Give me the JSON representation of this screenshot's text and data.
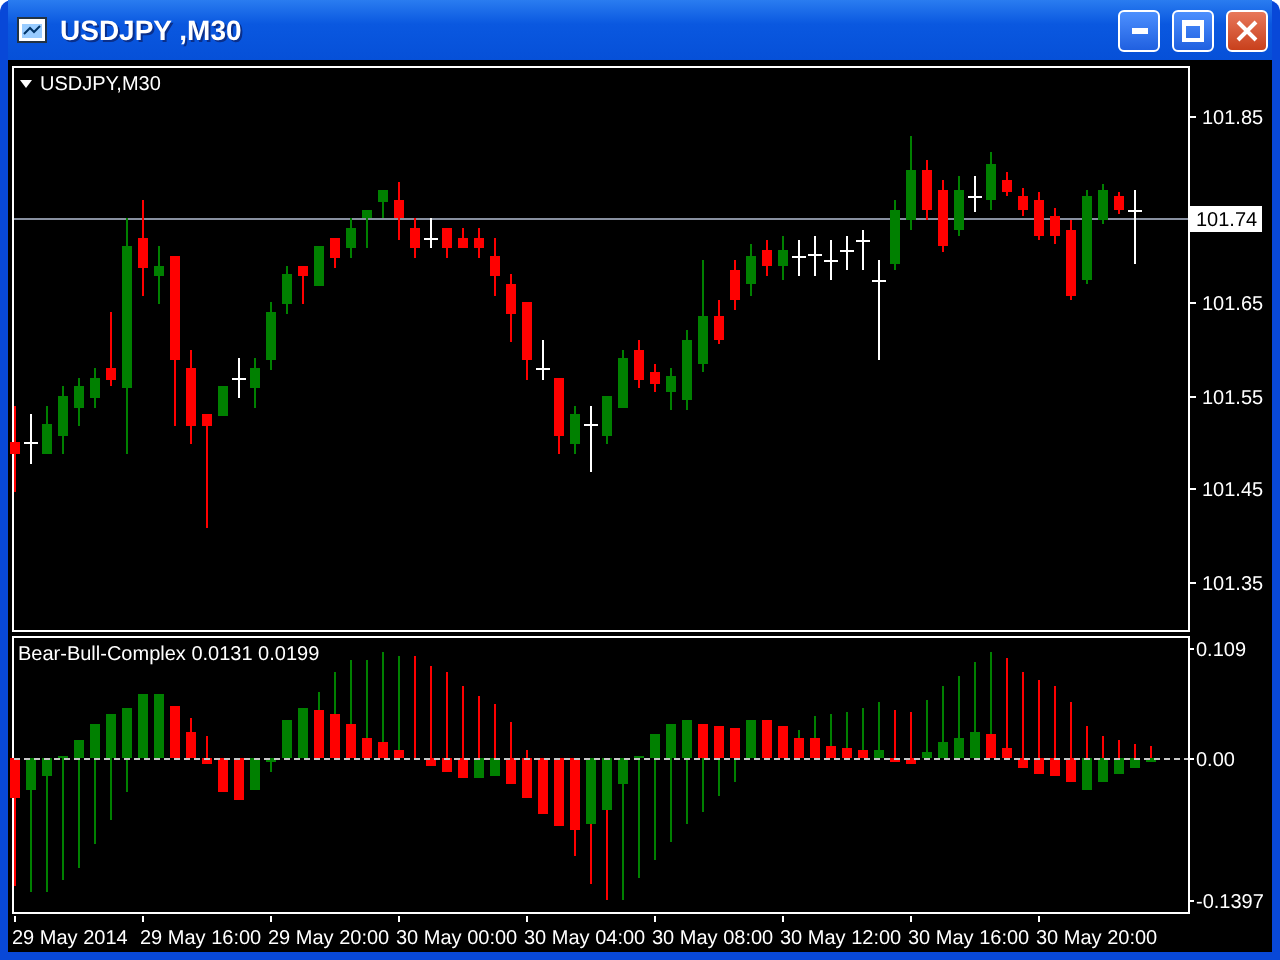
{
  "window": {
    "title": "USDJPY ,M30"
  },
  "chart": {
    "symbol_label": "USDJPY,M30",
    "price_axis": [
      "101.85",
      "101.65",
      "101.55",
      "101.45",
      "101.35"
    ],
    "current_price": "101.74"
  },
  "indicator": {
    "label": "Bear-Bull-Complex 0.0131 0.0199",
    "axis": [
      "0.109",
      "0.00",
      "-0.1397"
    ]
  },
  "time_axis": [
    "29 May 2014",
    "29 May 16:00",
    "29 May 20:00",
    "30 May 00:00",
    "30 May 04:00",
    "30 May 08:00",
    "30 May 12:00",
    "30 May 16:00",
    "30 May 20:00"
  ]
}
